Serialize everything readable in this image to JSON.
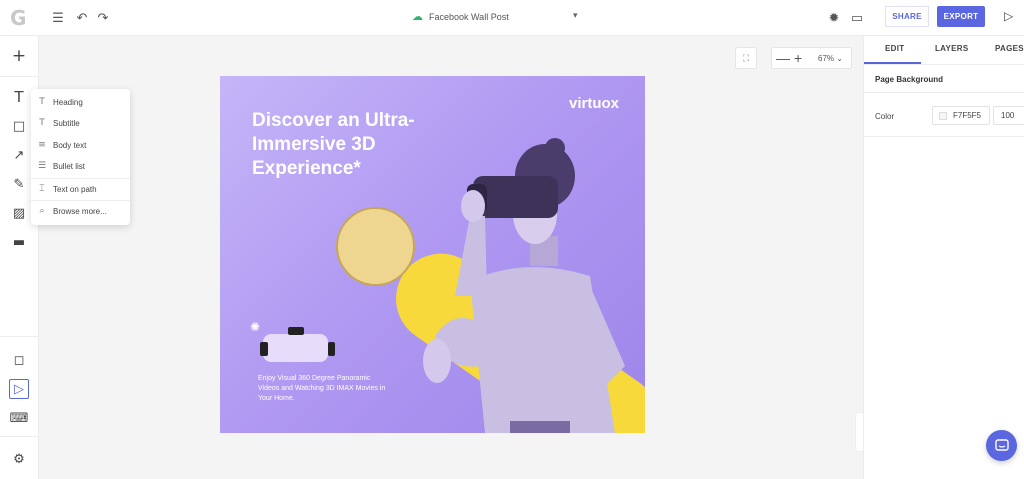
{
  "topbar": {
    "logo": "G",
    "doc_title": "Facebook Wall Post",
    "share_label": "SHARE",
    "export_label": "EXPORT",
    "icons": [
      "menu-icon",
      "undo-icon",
      "redo-icon",
      "cloud-saved-icon",
      "chevron-down-icon",
      "theme-icon",
      "comment-icon",
      "play-icon"
    ]
  },
  "leftbar": {
    "tools": [
      "add-icon",
      "text-icon",
      "shape-icon",
      "line-icon",
      "pen-icon",
      "image-icon",
      "component-icon",
      "frame-icon",
      "select-icon",
      "keyboard-icon",
      "settings-icon"
    ]
  },
  "text_menu": {
    "items": [
      {
        "label": "Heading",
        "icon": "T"
      },
      {
        "label": "Subtitle",
        "icon": "T"
      },
      {
        "label": "Body text",
        "icon": "≡"
      },
      {
        "label": "Bullet list",
        "icon": "☰"
      },
      {
        "label": "Text on path",
        "icon": "⌶"
      },
      {
        "label": "Browse more...",
        "icon": "⌕"
      }
    ]
  },
  "zoom": {
    "minus": "—",
    "plus": "+",
    "value": "67%"
  },
  "design": {
    "headline": "Discover an Ultra-Immersive 3D Experience*",
    "brand": "virtuox",
    "body": "Enjoy Visual 360 Degree Panoramic Videos and Watching 3D IMAX Movies in Your Home."
  },
  "right_panel": {
    "tabs": [
      "EDIT",
      "LAYERS",
      "PAGES"
    ],
    "section_title": "Page Background",
    "color_label": "Color",
    "color_value": "F7F5F5",
    "opacity_value": "100"
  },
  "colors": {
    "accent": "#5a67e0",
    "canvas_bg": "#b19af2",
    "yellow": "#f7d93c"
  }
}
